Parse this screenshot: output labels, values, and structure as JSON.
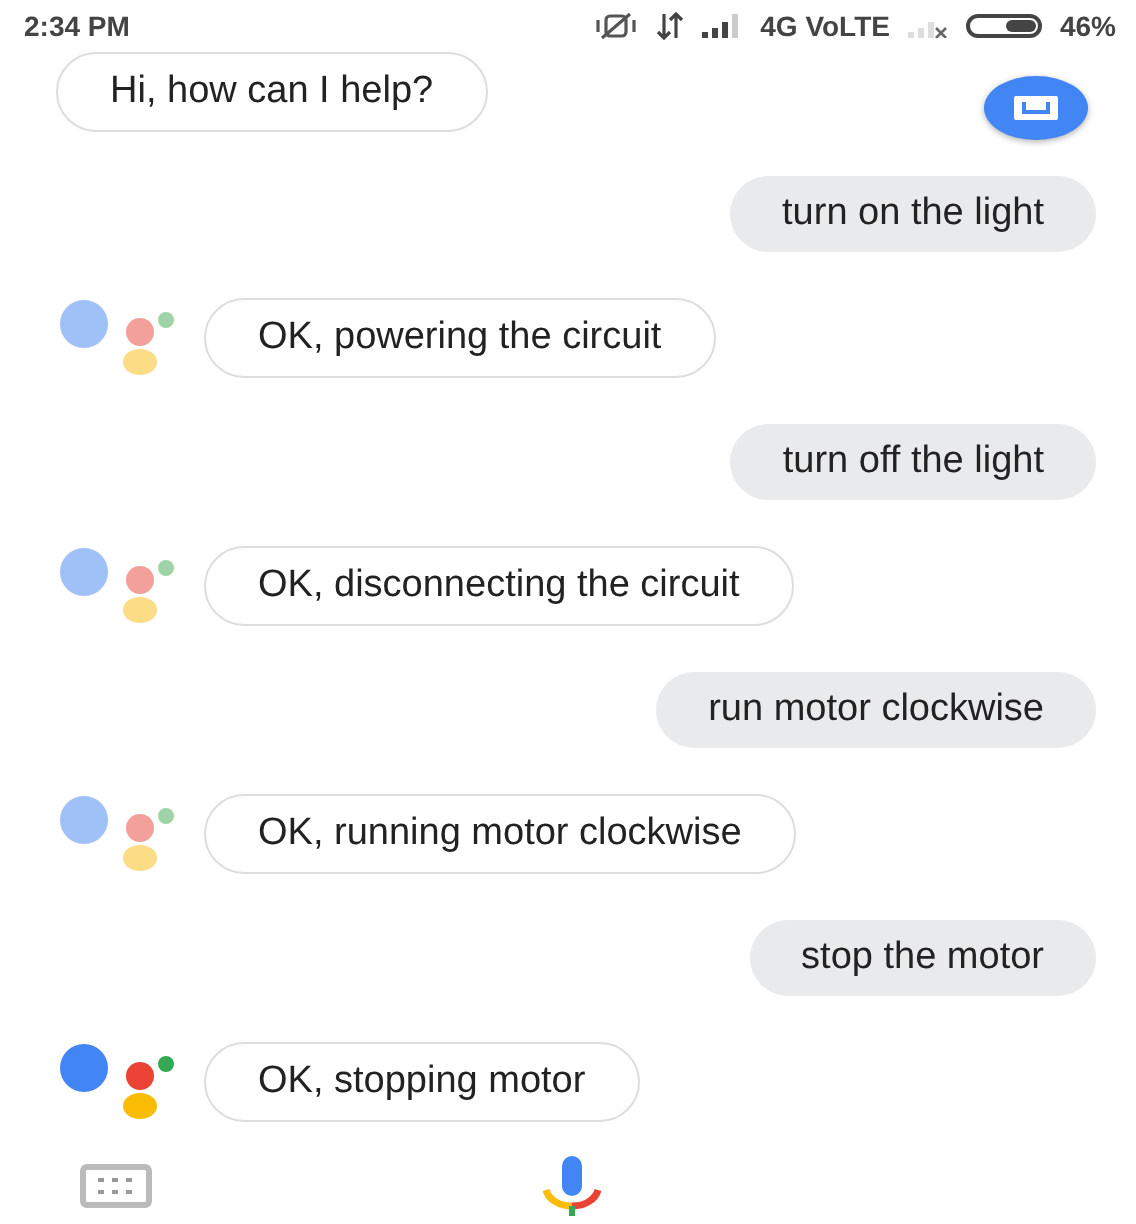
{
  "status_bar": {
    "time": "2:34 PM",
    "network": "4G VoLTE",
    "battery": "46%"
  },
  "greeting": "Hi, how can I help?",
  "messages": [
    {
      "kind": "user",
      "text": "turn on the light"
    },
    {
      "kind": "assistant",
      "text": "OK, powering the circuit",
      "active": false
    },
    {
      "kind": "user",
      "text": "turn off the light"
    },
    {
      "kind": "assistant",
      "text": "OK, disconnecting the circuit",
      "active": false
    },
    {
      "kind": "user",
      "text": "run motor clockwise"
    },
    {
      "kind": "assistant",
      "text": "OK, running motor clockwise",
      "active": false
    },
    {
      "kind": "user",
      "text": "stop the motor"
    },
    {
      "kind": "assistant",
      "text": "OK, stopping motor",
      "active": true
    }
  ]
}
